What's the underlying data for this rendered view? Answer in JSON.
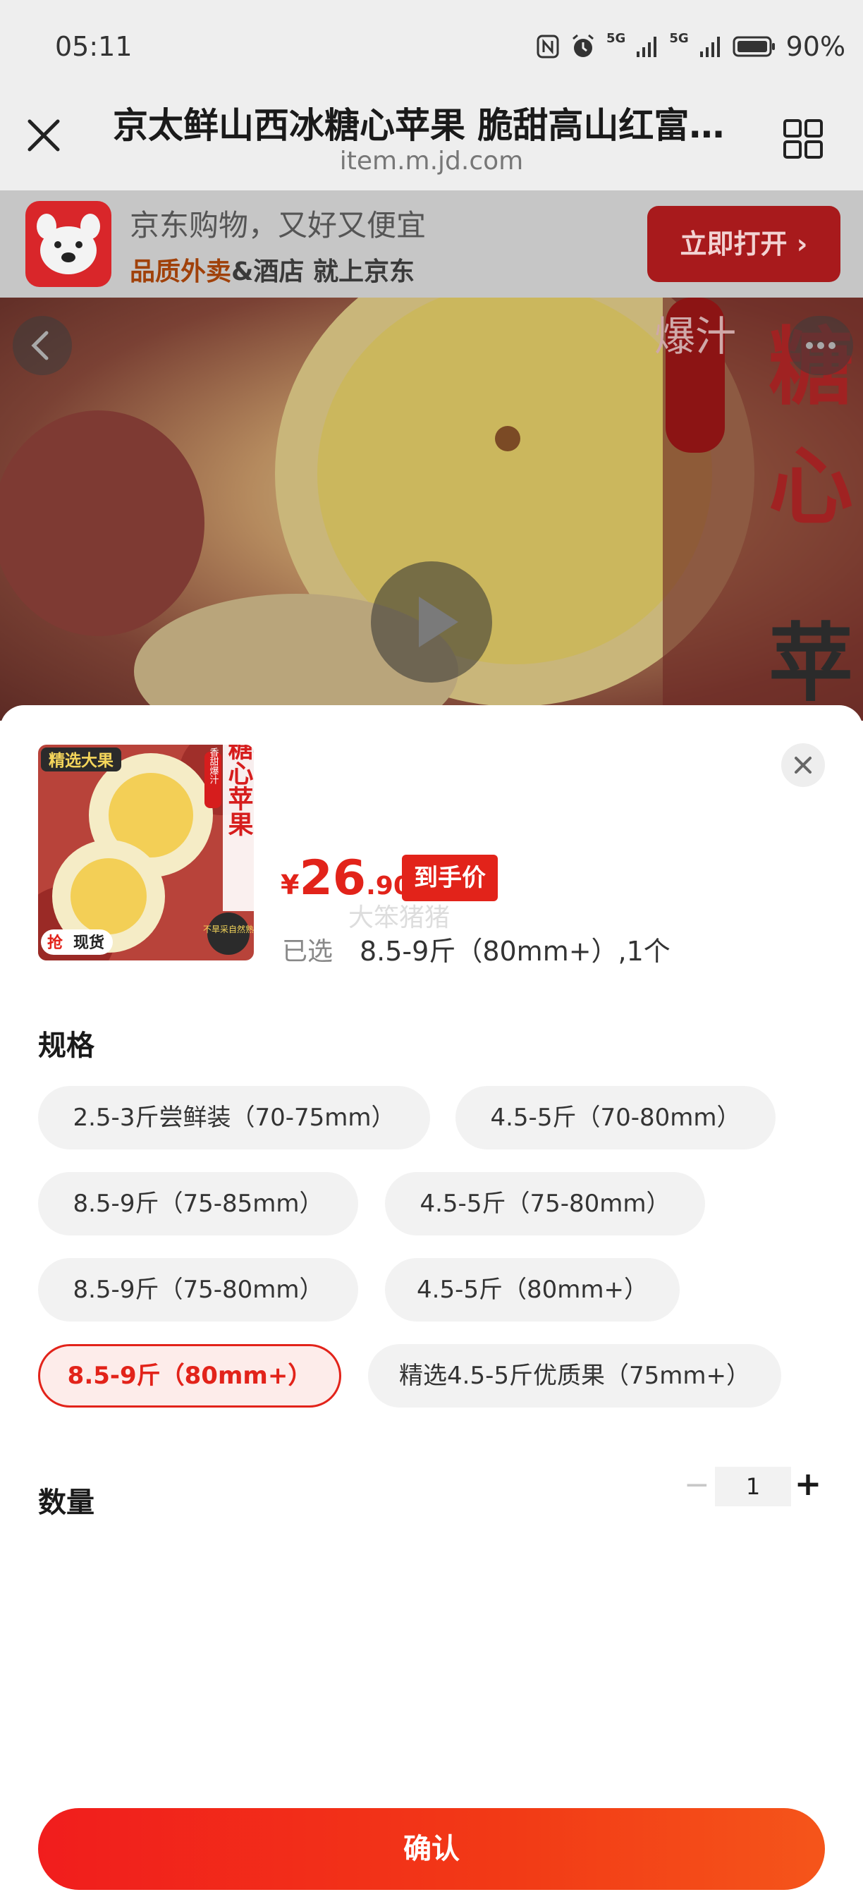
{
  "status_bar": {
    "time": "05:11",
    "signal_1": "5G",
    "signal_2": "5G",
    "battery": "90%"
  },
  "browser": {
    "title": "京太鲜山西冰糖心苹果 脆甜高山红富…",
    "domain": "item.m.jd.com"
  },
  "app_banner": {
    "line1": "京东购物，又好又便宜",
    "line2_highlight": "品质外卖",
    "line2_rest": "&酒店 就上京东",
    "open_button": "立即打开"
  },
  "product_media": {
    "overlay_text_1": "爆汁",
    "overlay_text_2": "糖",
    "overlay_text_3": "心",
    "overlay_text_4": "苹"
  },
  "product": {
    "thumb_tag": "精选大果",
    "thumb_side_tag": "香甜爆汁",
    "thumb_title": "冰糖心苹果",
    "thumb_badge": "不旱采自然熟",
    "thumb_stock_badge_1": "抢",
    "thumb_stock_badge_2": "现货",
    "price_currency": "¥",
    "price_int": "26",
    "price_dec": ".90",
    "price_tag": "到手价",
    "watermark": "大笨猪猪",
    "selected_label": "已选",
    "selected_value": "8.5-9斤（80mm+）,1个"
  },
  "spec": {
    "heading": "规格",
    "options": [
      "2.5-3斤尝鲜装（70-75mm）",
      "4.5-5斤（70-80mm）",
      "8.5-9斤（75-85mm）",
      "4.5-5斤（75-80mm）",
      "8.5-9斤（75-80mm）",
      "4.5-5斤（80mm+）",
      "8.5-9斤（80mm+）",
      "精选4.5-5斤优质果（75mm+）"
    ],
    "selected_option": "8.5-9斤（80mm+）"
  },
  "quantity": {
    "heading": "数量",
    "minus": "−",
    "value": "1",
    "plus": "+"
  },
  "confirm_button": "确认",
  "colors": {
    "accent": "#e2231a",
    "selected_bg": "#fdecea",
    "chip_bg": "#f2f2f2"
  }
}
